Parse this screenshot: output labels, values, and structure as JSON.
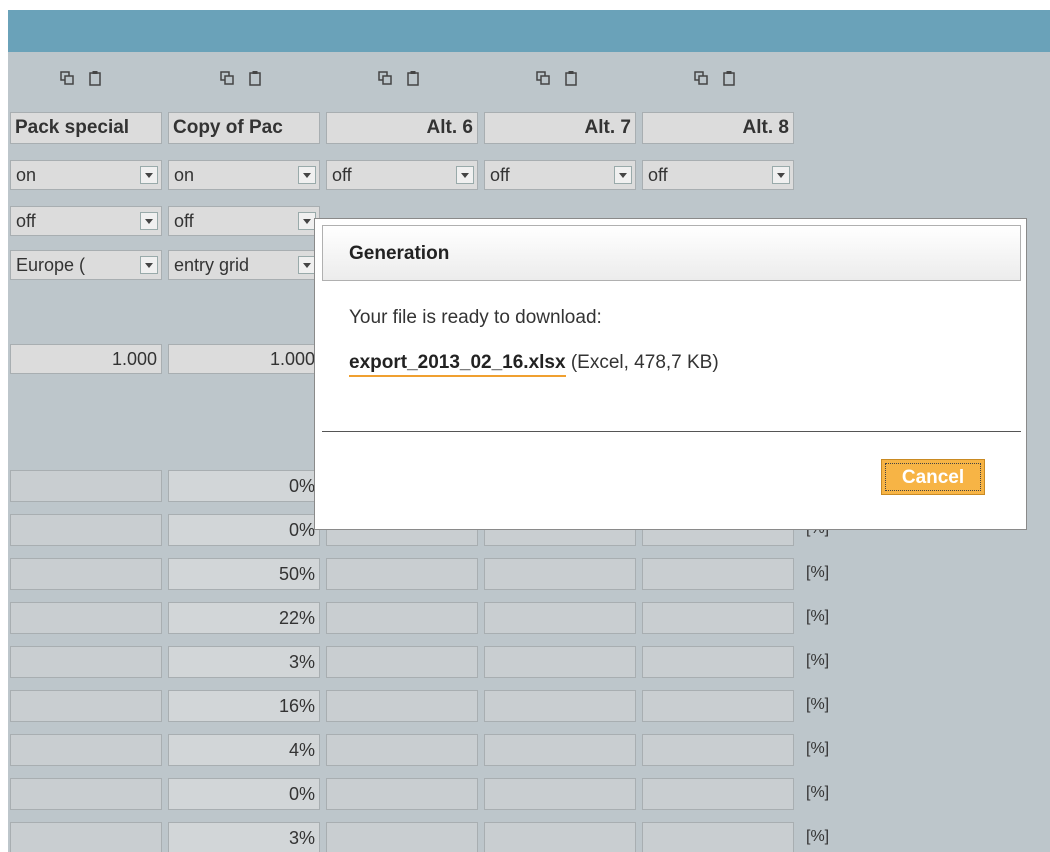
{
  "columns": [
    {
      "header": "Pack special",
      "row1": "on",
      "row2": "off",
      "row3": "Europe (",
      "number": "1.000",
      "percents": [
        "",
        "",
        "",
        "",
        "",
        "",
        "",
        "",
        ""
      ]
    },
    {
      "header": "Copy of Pac",
      "row1": "on",
      "row2": "off",
      "row3": "entry grid",
      "number": "1.000",
      "percents": [
        "0%",
        "0%",
        "50%",
        "22%",
        "3%",
        "16%",
        "4%",
        "0%",
        "3%"
      ]
    },
    {
      "header": "Alt. 6",
      "row1": "off"
    },
    {
      "header": "Alt. 7",
      "row1": "off"
    },
    {
      "header": "Alt. 8",
      "row1": "off"
    }
  ],
  "unit_label": "[%]",
  "dialog": {
    "title": "Generation",
    "message": "Your file is ready to download:",
    "file_link": "export_2013_02_16.xlsx",
    "file_info": " (Excel, 478,7 KB)",
    "cancel_label": "Cancel"
  },
  "colors": {
    "topbar": "#6aa2b9",
    "background": "#bdc6cb",
    "accent": "#f7b445"
  }
}
